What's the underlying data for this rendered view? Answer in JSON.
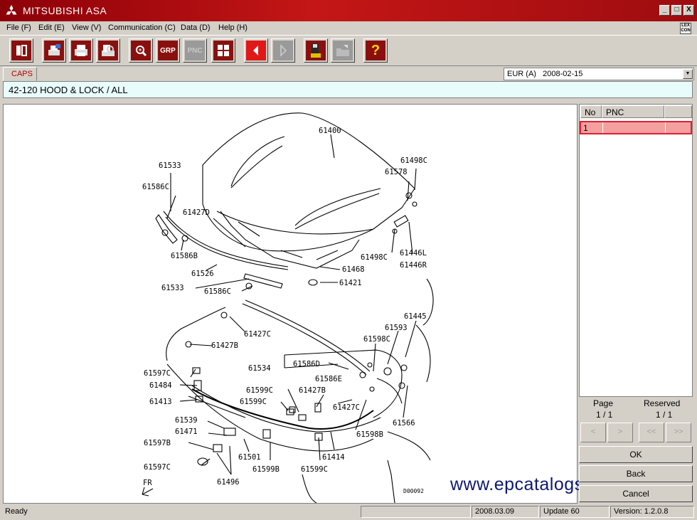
{
  "app": {
    "title": "MITSUBISHI ASA"
  },
  "window_buttons": [
    "_",
    "□",
    "X"
  ],
  "menu": [
    "File (F)",
    "Edit (E)",
    "View (V)",
    "Communication (C)",
    "Data (D)",
    "Help (H)"
  ],
  "menu_right_icon": "LEX\nCON",
  "toolbar": [
    {
      "icon": "exit-icon",
      "label": ""
    },
    {
      "icon": "print-preview-icon",
      "label": ""
    },
    {
      "icon": "printer-icon",
      "label": ""
    },
    {
      "icon": "search-document-icon",
      "label": ""
    },
    {
      "icon": "zoom-icon",
      "label": ""
    },
    {
      "icon": "grp-icon",
      "label": "GRP"
    },
    {
      "icon": "pnc-icon",
      "label": "PNC",
      "disabled": true
    },
    {
      "icon": "grid-view-icon",
      "label": ""
    },
    {
      "icon": "back-arrow-icon",
      "label": "◀"
    },
    {
      "icon": "forward-arrow-icon",
      "label": "▶",
      "disabled": true
    },
    {
      "icon": "save-icon",
      "label": ""
    },
    {
      "icon": "open-folder-icon",
      "label": "",
      "disabled": true
    },
    {
      "icon": "help-icon",
      "label": "?"
    }
  ],
  "caps_tab": "CAPS",
  "region_select": "EUR (A)   2008-02-15",
  "group_title": "42-120  HOOD & LOCK / ALL",
  "diagram": {
    "code": "D00092",
    "fr": "FR",
    "labels": [
      "61400",
      "61533",
      "61586C",
      "61427D",
      "61586B",
      "61526",
      "61533",
      "61586C",
      "61498C",
      "61578",
      "61498C",
      "61446L",
      "61446R",
      "61468",
      "61421",
      "61445",
      "61593",
      "61598C",
      "61427C",
      "61427B",
      "61534",
      "61586D",
      "61586E",
      "61597C",
      "61484",
      "61413",
      "61599C",
      "61427B",
      "61599C",
      "61427C",
      "61539",
      "61471",
      "61597B",
      "61501",
      "61598B",
      "61566",
      "61414",
      "61597C",
      "61599B",
      "61599C",
      "61496"
    ]
  },
  "watermark": "www.epcatalogs.com",
  "pnc_table": {
    "headers": [
      "No",
      "PNC"
    ],
    "rows": [
      [
        "1",
        ""
      ]
    ]
  },
  "pager": {
    "page_label": "Page",
    "page_value": "1 / 1",
    "reserved_label": "Reserved",
    "reserved_value": "1 / 1",
    "prev": "<",
    "next": ">",
    "first": "<<",
    "last": ">>"
  },
  "buttons": {
    "ok": "OK",
    "back": "Back",
    "cancel": "Cancel"
  },
  "status": {
    "ready": "Ready",
    "date": "2008.03.09",
    "update": "Update 60",
    "version": "Version: 1.2.0.8"
  },
  "colors": {
    "title_red": "#c41616",
    "selected_row": "#f4a0a0",
    "title_strip": "#e8fcfc"
  }
}
